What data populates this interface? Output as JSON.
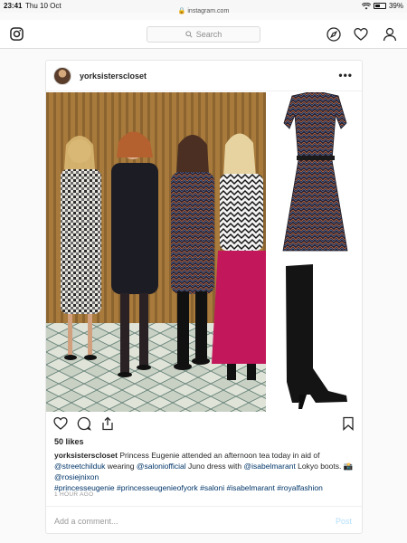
{
  "status_bar": {
    "time": "23:41",
    "date": "Thu 10 Oct",
    "url": "instagram.com",
    "battery_text": "39%",
    "battery_level": 0.39
  },
  "nav": {
    "search_placeholder": "Search",
    "icons": [
      "instagram-logo-icon",
      "compass-icon",
      "heart-icon",
      "profile-icon"
    ]
  },
  "post": {
    "username": "yorksisterscloset",
    "more_label": "•••",
    "likes": "50 likes",
    "caption": {
      "username": "yorksisterscloset",
      "text_1": "Princess Eugenie attended an afternoon tea today in aid of",
      "mention_1": "@streetchilduk",
      "text_2": "wearing",
      "mention_2": "@saloniofficial",
      "text_3": "Juno dress with",
      "mention_3": "@isabelmarant",
      "text_4": "Lokyo boots. 📸",
      "mention_4": "@rosiejnixon",
      "hashtags": [
        "#princesseugenie",
        "#princesseugenieofyork",
        "#saloni",
        "#isabelmarant",
        "#royalfashion"
      ]
    },
    "time_ago": "1 HOUR AGO",
    "comment_placeholder": "Add a comment...",
    "post_button": "Post"
  },
  "colors": {
    "link": "#003569",
    "muted": "#999999",
    "border": "#dbdbdb",
    "post_button": "#b2dffc"
  }
}
